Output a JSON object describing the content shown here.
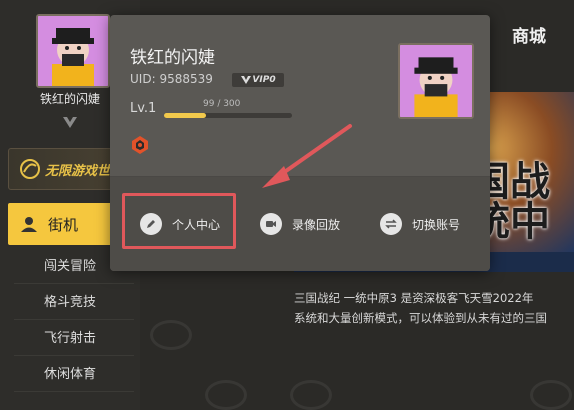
{
  "sidebar": {
    "username": "铁红的闪婕",
    "promo_label": "无限游戏世",
    "nav_main_label": "街机",
    "nav_sub_items": [
      "闯关冒险",
      "格斗竞技",
      "飞行射击",
      "休闲体育"
    ]
  },
  "header": {
    "store_label": "商城"
  },
  "content": {
    "art_text": "国战 统中",
    "desc_line1": "三国战纪 一统中原3 是资深极客飞天雪2022年",
    "desc_line2": "系统和大量创新模式，可以体验到从未有过的三国"
  },
  "popup": {
    "name": "铁红的闪婕",
    "uid_label": "UID:",
    "uid_value": "9588539",
    "vip_label": "VIP0",
    "level_label": "Lv.1",
    "exp_text": "99 / 300",
    "exp_fraction": 0.33,
    "actions": [
      {
        "label": "个人中心",
        "icon": "pencil-icon"
      },
      {
        "label": "录像回放",
        "icon": "video-icon"
      },
      {
        "label": "切换账号",
        "icon": "switch-icon"
      }
    ]
  },
  "colors": {
    "accent": "#f5c73e",
    "highlight": "#e0585b",
    "popup_bg": "#5a5854",
    "page_bg": "#2b2a27"
  }
}
